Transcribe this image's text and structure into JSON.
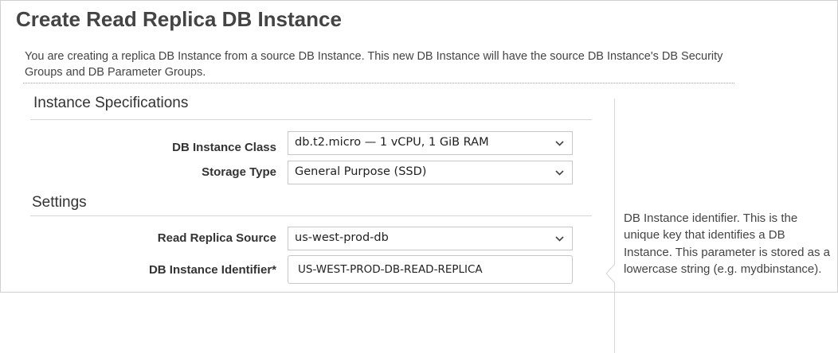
{
  "page": {
    "title": "Create Read Replica DB Instance",
    "description": "You are creating a replica DB Instance from a source DB Instance. This new DB Instance will have the source DB Instance's DB Security Groups and DB Parameter Groups."
  },
  "instance_specifications": {
    "heading": "Instance Specifications",
    "db_instance_class": {
      "label": "DB Instance Class",
      "value": "db.t2.micro — 1 vCPU, 1 GiB RAM"
    },
    "storage_type": {
      "label": "Storage Type",
      "value": "General Purpose (SSD)"
    }
  },
  "settings": {
    "heading": "Settings",
    "read_replica_source": {
      "label": "Read Replica Source",
      "value": "us-west-prod-db"
    },
    "db_instance_identifier": {
      "label": "DB Instance Identifier*",
      "value": "US-WEST-PROD-DB-READ-REPLICA"
    }
  },
  "help_panel": {
    "text": "DB Instance identifier. This is the unique key that identifies a DB Instance. This parameter is stored as a lowercase string (e.g. mydbinstance)."
  },
  "icons": {
    "select_arrow": "chevron-down-icon",
    "help_pointer": "caret-left-icon"
  },
  "colors": {
    "text": "#333333",
    "border": "#c6c6c6",
    "rule": "#d5d5d5"
  }
}
